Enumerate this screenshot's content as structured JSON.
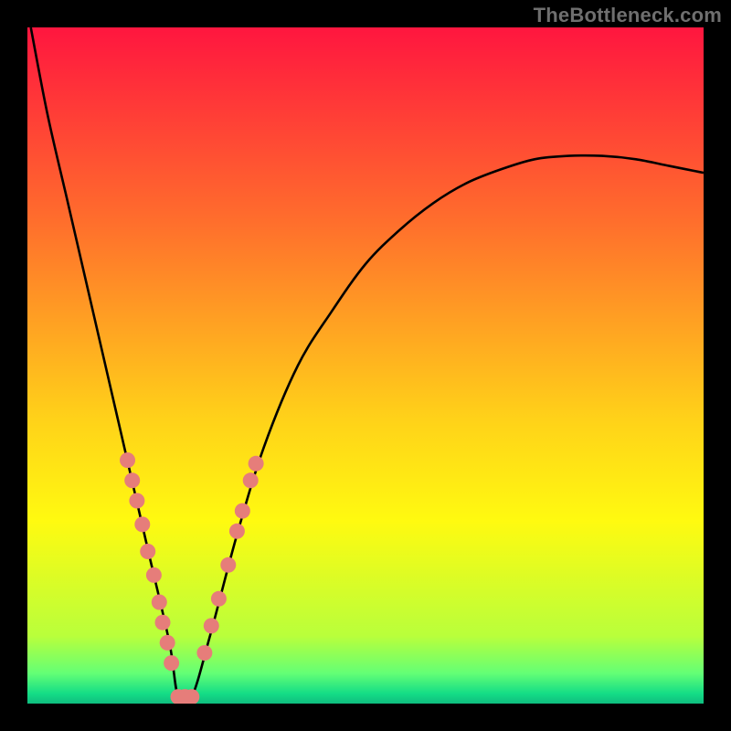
{
  "watermark": {
    "text": "TheBottleneck.com"
  },
  "chart_data": {
    "type": "line",
    "title": "",
    "xlabel": "",
    "ylabel": "",
    "xlim": [
      0,
      1
    ],
    "ylim": [
      0,
      1
    ],
    "grid": false,
    "legend": false,
    "background_gradient": {
      "orientation": "vertical",
      "stops": [
        {
          "pos": 0.0,
          "color": "#ff163f"
        },
        {
          "pos": 0.29,
          "color": "#ff6f2c"
        },
        {
          "pos": 0.58,
          "color": "#ffd219"
        },
        {
          "pos": 0.73,
          "color": "#fffa10"
        },
        {
          "pos": 0.9,
          "color": "#b9ff3b"
        },
        {
          "pos": 0.955,
          "color": "#64ff75"
        },
        {
          "pos": 0.985,
          "color": "#14dd86"
        },
        {
          "pos": 1.0,
          "color": "#0fbd7f"
        }
      ]
    },
    "series": [
      {
        "name": "bottleneck-curve",
        "color": "#000000",
        "x": [
          0.005,
          0.03,
          0.06,
          0.09,
          0.12,
          0.15,
          0.18,
          0.21,
          0.223,
          0.243,
          0.27,
          0.31,
          0.35,
          0.4,
          0.45,
          0.5,
          0.55,
          0.6,
          0.65,
          0.7,
          0.75,
          0.8,
          0.85,
          0.9,
          0.95,
          1.0
        ],
        "y": [
          1.0,
          0.87,
          0.74,
          0.61,
          0.48,
          0.35,
          0.22,
          0.09,
          0.01,
          0.01,
          0.1,
          0.25,
          0.38,
          0.5,
          0.58,
          0.65,
          0.7,
          0.74,
          0.77,
          0.79,
          0.805,
          0.81,
          0.81,
          0.805,
          0.795,
          0.785
        ]
      },
      {
        "name": "scatter-left",
        "type": "scatter",
        "color": "#e67d7a",
        "x": [
          0.148,
          0.155,
          0.162,
          0.17,
          0.178,
          0.187,
          0.195,
          0.2,
          0.207,
          0.213
        ],
        "y": [
          0.36,
          0.33,
          0.3,
          0.265,
          0.225,
          0.19,
          0.15,
          0.12,
          0.09,
          0.06
        ]
      },
      {
        "name": "scatter-bottom",
        "type": "scatter",
        "color": "#e67d7a",
        "x": [
          0.223,
          0.233,
          0.243
        ],
        "y": [
          0.01,
          0.01,
          0.01
        ]
      },
      {
        "name": "scatter-right",
        "type": "scatter",
        "color": "#e67d7a",
        "x": [
          0.262,
          0.272,
          0.283,
          0.297,
          0.31,
          0.318,
          0.33,
          0.338
        ],
        "y": [
          0.075,
          0.115,
          0.155,
          0.205,
          0.255,
          0.285,
          0.33,
          0.355
        ]
      }
    ]
  }
}
